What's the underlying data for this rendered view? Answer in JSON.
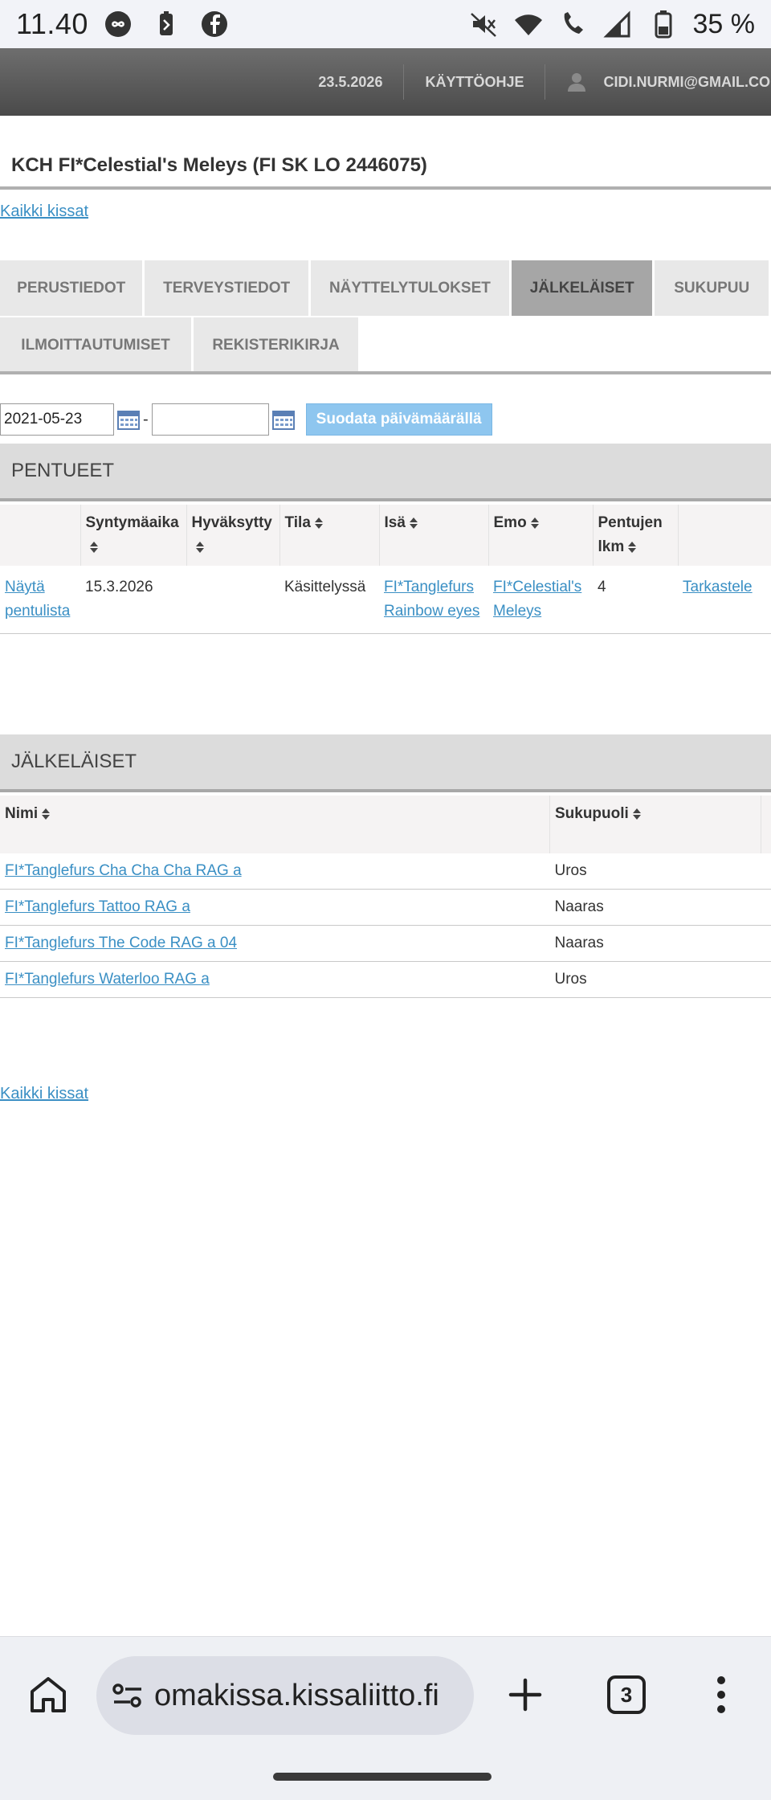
{
  "status_bar": {
    "time": "11.40",
    "battery": "35 %",
    "left_icons": [
      "helix-icon",
      "battery-saver-icon",
      "facebook-icon"
    ],
    "right_icons": [
      "mute-icon",
      "wifi-icon",
      "wifi-call-icon",
      "signal-icon",
      "battery-icon"
    ]
  },
  "top_bar": {
    "date": "23.5.2026",
    "manual": "KÄYTTÖOHJE",
    "user": "CIDI.NURMI@GMAIL.COM"
  },
  "page": {
    "title": "KCH FI*Celestial's Meleys (FI SK LO 2446075)",
    "all_cats_link": "Kaikki kissat"
  },
  "tabs": [
    {
      "label": "PERUSTIEDOT",
      "active": false
    },
    {
      "label": "TERVEYSTIEDOT",
      "active": false
    },
    {
      "label": "NÄYTTELYTULOKSET",
      "active": false
    },
    {
      "label": "JÄLKELÄISET",
      "active": true
    },
    {
      "label": "SUKUPUU",
      "active": false
    },
    {
      "label": "ILMOITTAUTUMISET",
      "active": false
    },
    {
      "label": "REKISTERIKIRJA",
      "active": false
    }
  ],
  "filter": {
    "start_date": "2021-05-23",
    "end_date": "",
    "separator": "-",
    "button": "Suodata päivämäärällä"
  },
  "litters": {
    "heading": "PENTUEET",
    "columns": [
      "",
      "Syntymäaika",
      "Hyväksytty",
      "Tila",
      "Isä",
      "Emo",
      "Pentujen lkm",
      ""
    ],
    "rows": [
      {
        "show_list": "Näytä pentulista",
        "birth_date": "15.3.2026",
        "approved": "",
        "status": "Käsittelyssä",
        "sire": "FI*Tanglefurs Rainbow eyes",
        "dam": "FI*Celestial's Meleys",
        "kitten_count": "4",
        "action": "Tarkastele"
      }
    ]
  },
  "offspring": {
    "heading": "JÄLKELÄISET",
    "columns": [
      "Nimi",
      "Sukupuoli"
    ],
    "rows": [
      {
        "name": "FI*Tanglefurs Cha Cha Cha RAG a",
        "sex": "Uros"
      },
      {
        "name": "FI*Tanglefurs Tattoo RAG a",
        "sex": "Naaras"
      },
      {
        "name": "FI*Tanglefurs The Code RAG a 04",
        "sex": "Naaras"
      },
      {
        "name": "FI*Tanglefurs Waterloo RAG a",
        "sex": "Uros"
      }
    ]
  },
  "browser": {
    "url": "omakissa.kissaliitto.fi",
    "tab_count": "3"
  }
}
